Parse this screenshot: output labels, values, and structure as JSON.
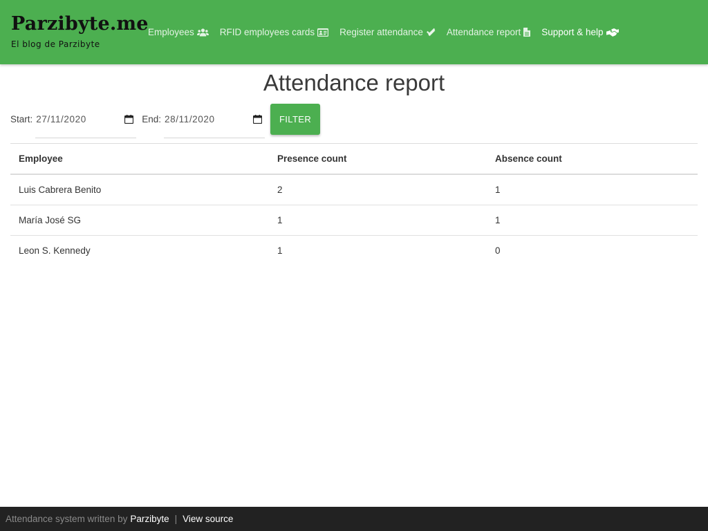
{
  "brand": {
    "title": "Parzibyte.me",
    "subtitle": "El blog de Parzibyte"
  },
  "nav": {
    "items": [
      {
        "label": "Employees",
        "icon": "users-icon",
        "active": false
      },
      {
        "label": "RFID employees cards",
        "icon": "id-card-icon",
        "active": false
      },
      {
        "label": "Register attendance",
        "icon": "double-check-icon",
        "active": false
      },
      {
        "label": "Attendance report",
        "icon": "file-icon",
        "active": false
      },
      {
        "label": "Support & help",
        "icon": "hands-helping-icon",
        "active": true
      }
    ]
  },
  "page": {
    "title": "Attendance report"
  },
  "filter": {
    "start_label": "Start:",
    "start_value": "27/11/2020",
    "end_label": "End:",
    "end_value": "28/11/2020",
    "button_label": "Filter"
  },
  "table": {
    "headers": [
      "Employee",
      "Presence count",
      "Absence count"
    ],
    "rows": [
      [
        "Luis Cabrera Benito",
        "2",
        "1"
      ],
      [
        "María José SG",
        "1",
        "1"
      ],
      [
        "Leon S. Kennedy",
        "1",
        "0"
      ]
    ]
  },
  "footer": {
    "text": "Attendance system written by",
    "author_link": "Parzibyte",
    "separator": "|",
    "source_link": "View source"
  },
  "colors": {
    "navbar": "#4caf50",
    "button": "#4caf50",
    "footer": "#222222"
  }
}
